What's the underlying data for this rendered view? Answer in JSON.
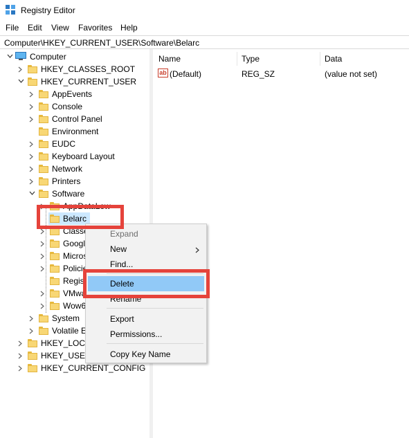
{
  "window": {
    "title": "Registry Editor"
  },
  "menu": [
    "File",
    "Edit",
    "View",
    "Favorites",
    "Help"
  ],
  "address": "Computer\\HKEY_CURRENT_USER\\Software\\Belarc",
  "tree": {
    "computer": "Computer",
    "hkcr": "HKEY_CLASSES_ROOT",
    "hkcu": "HKEY_CURRENT_USER",
    "hkcu_children": [
      "AppEvents",
      "Console",
      "Control Panel",
      "Environment",
      "EUDC",
      "Keyboard Layout",
      "Network",
      "Printers",
      "Software"
    ],
    "software_children": [
      "AppDataLow",
      "Belarc",
      "Classes",
      "Google",
      "Microsoft",
      "Policies",
      "RegisteredApplications",
      "VMware, Inc.",
      "Wow6432Node"
    ],
    "after_software": [
      "System",
      "Volatile Environment"
    ],
    "hklm": "HKEY_LOCAL_MACHINE",
    "hku": "HKEY_USERS",
    "hkcc": "HKEY_CURRENT_CONFIG"
  },
  "list": {
    "columns": [
      "Name",
      "Type",
      "Data"
    ],
    "rows": [
      {
        "name": "(Default)",
        "type": "REG_SZ",
        "data": "(value not set)",
        "icon": "ab-string-icon"
      }
    ]
  },
  "context_menu": {
    "items": [
      "Expand",
      "New",
      "Find...",
      "Delete",
      "Rename",
      "Export",
      "Permissions...",
      "Copy Key Name"
    ],
    "disabled": [
      "Expand"
    ],
    "highlighted": "Delete"
  },
  "colors": {
    "highlight_border": "#e5433b",
    "menu_hover": "#91c9f7",
    "folder": "#f8d775"
  }
}
